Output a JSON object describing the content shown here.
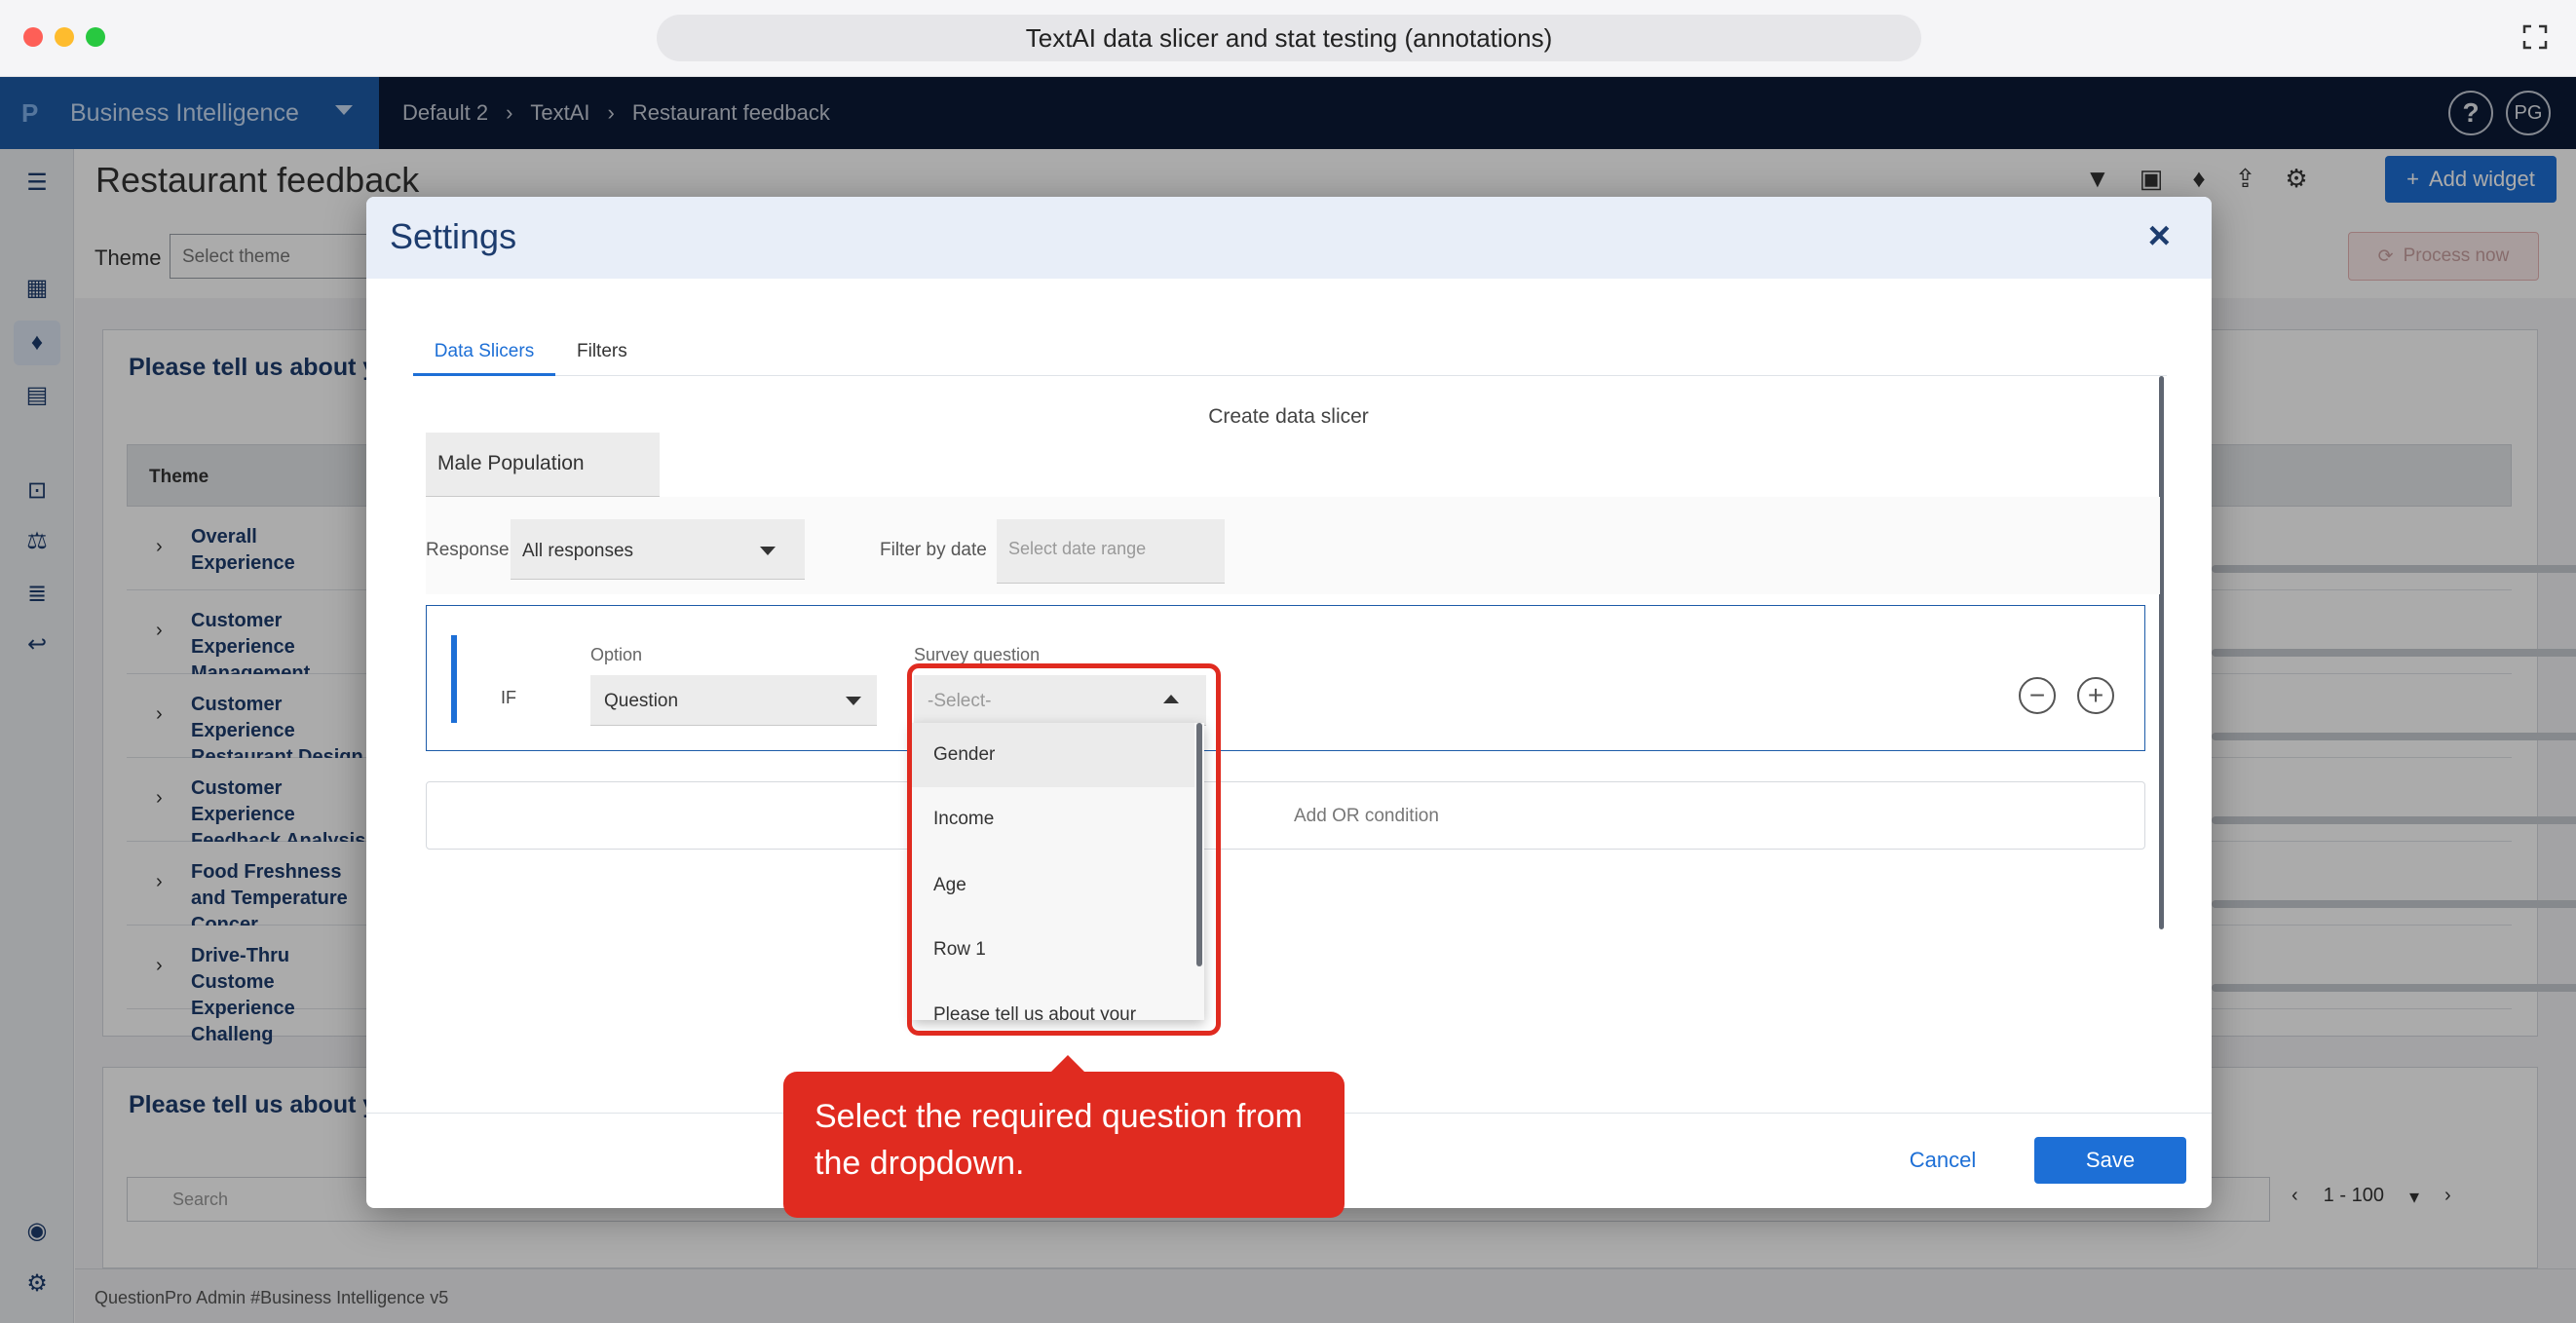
{
  "window": {
    "title": "TextAI data slicer and stat testing (annotations)"
  },
  "app": {
    "name": "Business Intelligence",
    "user_initials": "PG"
  },
  "breadcrumb": [
    "Default 2",
    "TextAI",
    "Restaurant feedback"
  ],
  "page": {
    "title": "Restaurant feedback",
    "theme_label": "Theme",
    "theme_placeholder": "Select theme",
    "add_widget": "Add widget",
    "process_now": "Process now",
    "card1_title": "Please tell us about yo",
    "card2_title": "Please tell us about yo",
    "table_header": "Theme",
    "rows": [
      "Overall Experience",
      "Customer Experience Management",
      "Customer Experience Restaurant Design",
      "Customer Experience Feedback Analysis",
      "Food Freshness and Temperature Concer",
      "Drive-Thru Custome Experience Challeng"
    ],
    "search_placeholder": "Search",
    "pager": "1 - 100",
    "footer": "QuestionPro Admin #Business Intelligence v5"
  },
  "modal": {
    "title": "Settings",
    "tabs": [
      "Data Slicers",
      "Filters"
    ],
    "section_title": "Create data slicer",
    "slicer_name": "Male Population",
    "response_status_label": "Response status",
    "response_status_value": "All responses",
    "filter_date_label": "Filter by date",
    "date_placeholder": "Select date range",
    "condition": {
      "if_label": "IF",
      "option_label": "Option",
      "option_value": "Question",
      "survey_question_label": "Survey question",
      "survey_question_placeholder": "-Select-"
    },
    "dropdown_options": [
      "Gender",
      "Income",
      "Age",
      "Row 1",
      "Please tell us about your"
    ],
    "add_or": "Add OR condition",
    "cancel": "Cancel",
    "save": "Save"
  },
  "annotation": {
    "text": "Select the required question from the dropdown."
  },
  "colors": {
    "accent": "#1d6fd6",
    "annotation": "#e02b20",
    "navbar": "#0b1a36"
  }
}
